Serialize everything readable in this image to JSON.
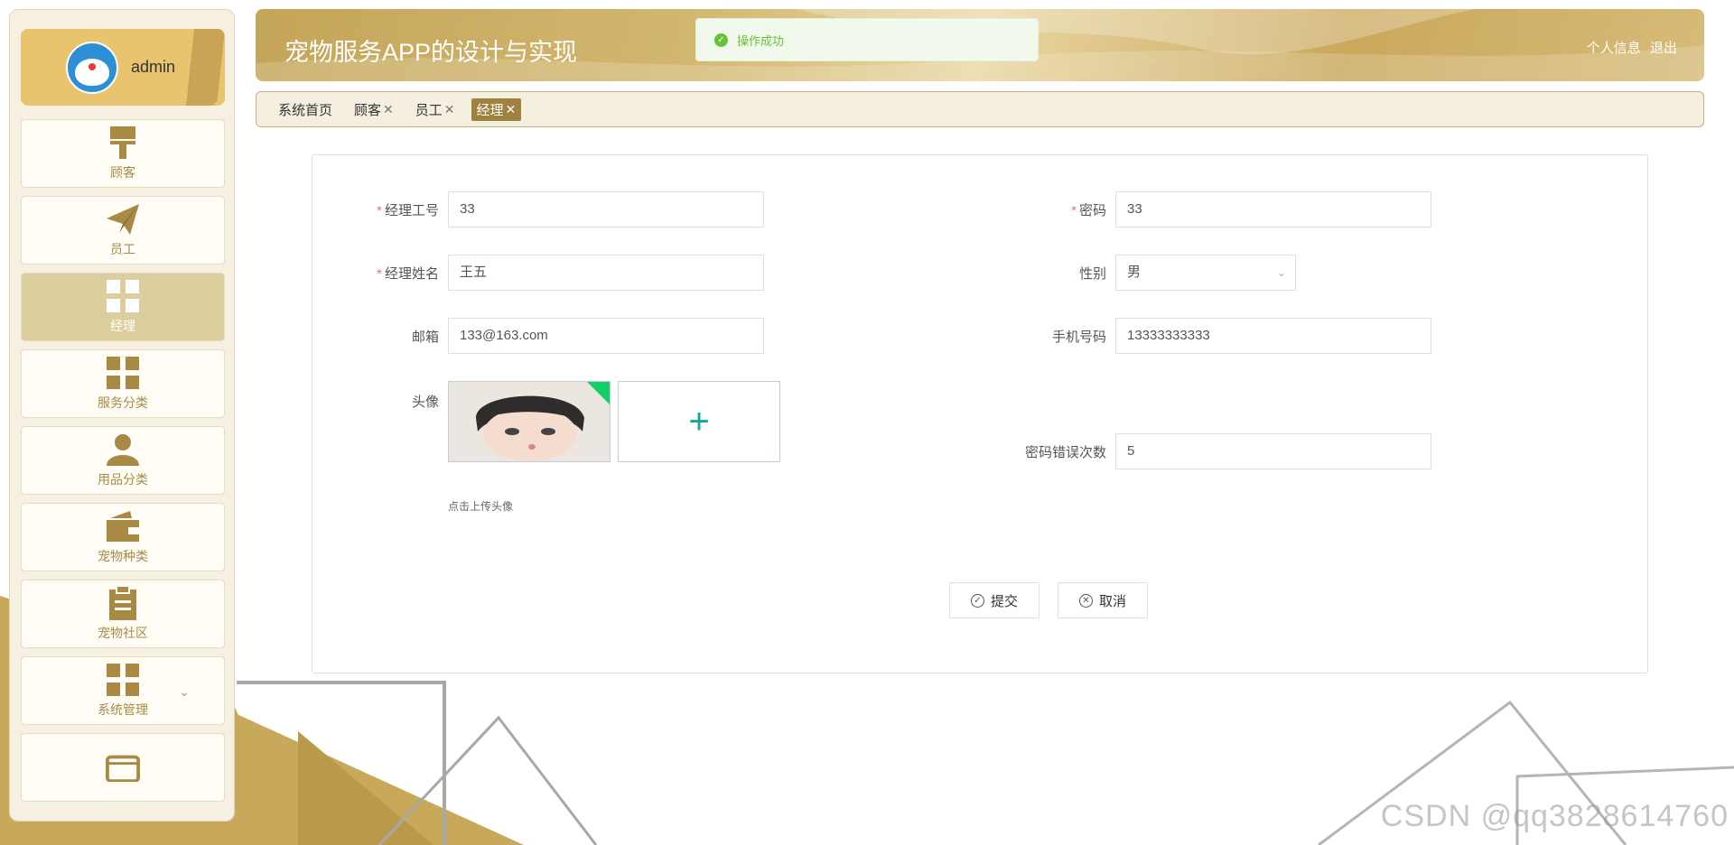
{
  "app": {
    "title": "宠物服务APP的设计与实现",
    "actions": [
      "个人信息",
      "退出"
    ]
  },
  "user": {
    "name": "admin"
  },
  "toast": {
    "message": "操作成功"
  },
  "sidebar": {
    "items": [
      {
        "label": "顾客",
        "icon": "paint-roller-icon",
        "active": false
      },
      {
        "label": "员工",
        "icon": "paper-plane-icon",
        "active": false
      },
      {
        "label": "经理",
        "icon": "grid-icon",
        "active": true
      },
      {
        "label": "服务分类",
        "icon": "grid-icon",
        "active": false
      },
      {
        "label": "用品分类",
        "icon": "person-icon",
        "active": false
      },
      {
        "label": "宠物种类",
        "icon": "wallet-icon",
        "active": false
      },
      {
        "label": "宠物社区",
        "icon": "clipboard-icon",
        "active": false
      },
      {
        "label": "系统管理",
        "icon": "grid-icon",
        "active": false,
        "expandable": true
      },
      {
        "label": "",
        "icon": "window-icon",
        "active": false
      }
    ]
  },
  "tags": [
    {
      "label": "系统首页",
      "closable": false,
      "active": false
    },
    {
      "label": "顾客",
      "closable": true,
      "active": false
    },
    {
      "label": "员工",
      "closable": true,
      "active": false
    },
    {
      "label": "经理",
      "closable": true,
      "active": true
    }
  ],
  "form": {
    "manager_id": {
      "label": "经理工号",
      "value": "33",
      "required": true
    },
    "password": {
      "label": "密码",
      "value": "33",
      "required": true
    },
    "manager_name": {
      "label": "经理姓名",
      "value": "王五",
      "required": true
    },
    "gender": {
      "label": "性别",
      "value": "男"
    },
    "email": {
      "label": "邮箱",
      "value": "133@163.com"
    },
    "phone": {
      "label": "手机号码",
      "value": "13333333333"
    },
    "avatar": {
      "label": "头像",
      "tip": "点击上传头像"
    },
    "pwd_errors": {
      "label": "密码错误次数",
      "value": "5"
    },
    "submit_label": "提交",
    "cancel_label": "取消"
  },
  "watermark": "CSDN @qq3828614760",
  "colors": {
    "accent": "#c4a559",
    "menu_text": "#a88a45",
    "active_tag": "#9f8140",
    "required": "#f56c6c",
    "success": "#67c23a"
  }
}
